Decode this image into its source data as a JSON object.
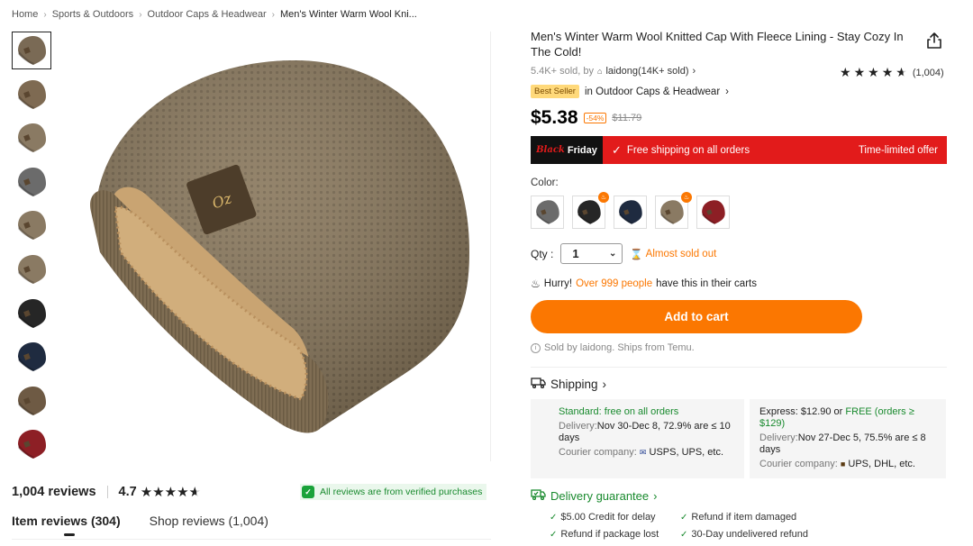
{
  "breadcrumb": {
    "items": [
      "Home",
      "Sports & Outdoors",
      "Outdoor Caps & Headwear"
    ],
    "current": "Men's Winter Warm Wool Kni..."
  },
  "product": {
    "title": "Men's Winter Warm Wool Knitted Cap With Fleece Lining - Stay Cozy In The Cold!",
    "sold_text": "5.4K+ sold, by",
    "store": "laidong(14K+ sold)",
    "rating_count": "(1,004)",
    "best_seller": "Best Seller",
    "category_link": "in Outdoor Caps & Headwear",
    "price": "$5.38",
    "discount": "-54%",
    "original_price": "$11.79"
  },
  "promo": {
    "logo_a": "Black",
    "logo_b": "Friday",
    "free_shipping": "Free shipping on all orders",
    "limited": "Time-limited offer"
  },
  "options": {
    "color_label": "Color:",
    "swatches": [
      {
        "name": "gray",
        "color": "#6b6b6b",
        "hot": false
      },
      {
        "name": "black",
        "color": "#262626",
        "hot": true
      },
      {
        "name": "navy",
        "color": "#1f2b40",
        "hot": false
      },
      {
        "name": "khaki",
        "color": "#8a7a63",
        "hot": true
      },
      {
        "name": "wine",
        "color": "#8d1f25",
        "hot": false
      }
    ],
    "qty_label": "Qty :",
    "qty_value": "1",
    "almost_sold": "Almost sold out"
  },
  "urgency": {
    "hurry": "Hurry!",
    "people": "Over 999 people",
    "rest": "have this in their carts"
  },
  "cart": {
    "add_label": "Add to cart",
    "sold_by": "Sold by laidong. Ships from Temu."
  },
  "shipping": {
    "title": "Shipping",
    "standard": {
      "label": "Standard: free on all orders",
      "delivery_label": "Delivery:",
      "delivery": "Nov 30-Dec 8, 72.9% are ≤ 10 days",
      "courier_label": "Courier company:",
      "couriers": "USPS, UPS, etc."
    },
    "express": {
      "label": "Express: $12.90 or",
      "free": "FREE (orders ≥ $129)",
      "delivery_label": "Delivery:",
      "delivery": "Nov 27-Dec 5, 75.5% are ≤ 8 days",
      "courier_label": "Courier company:",
      "couriers": "UPS, DHL, etc."
    }
  },
  "guarantee": {
    "title": "Delivery guarantee",
    "items": [
      "$5.00 Credit for delay",
      "Refund if item damaged",
      "Refund if package lost",
      "30-Day undelivered refund"
    ]
  },
  "reviews": {
    "count": "1,004 reviews",
    "rating": "4.7",
    "verified": "All reviews are from verified purchases",
    "tab_items": "Item reviews (304)",
    "tab_shop": "Shop reviews (1,004)"
  },
  "thumbs": [
    {
      "color": "#7a6a55"
    },
    {
      "color": "#7e6a52"
    },
    {
      "color": "#8a7a63"
    },
    {
      "color": "#6b6b6b"
    },
    {
      "color": "#8a7a63"
    },
    {
      "color": "#8a7a63"
    },
    {
      "color": "#262626"
    },
    {
      "color": "#1f2b40"
    },
    {
      "color": "#6e5a44"
    },
    {
      "color": "#8d1f25"
    }
  ],
  "colors": {
    "accent": "#fb7701",
    "promo_red": "#e21b1b",
    "success": "#198a2e"
  }
}
